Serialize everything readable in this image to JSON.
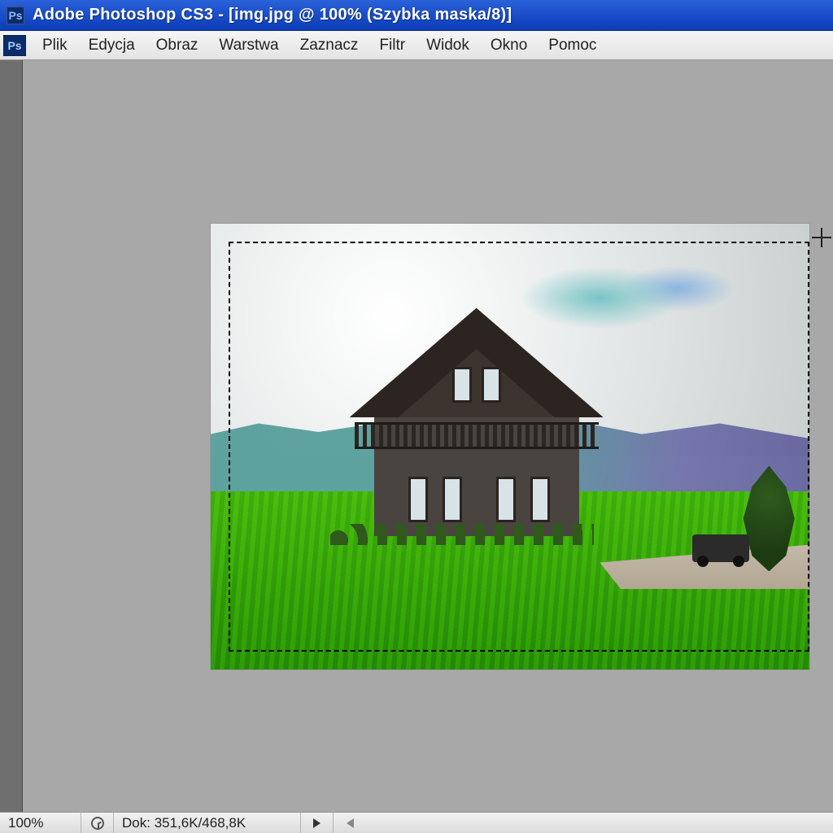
{
  "titlebar": {
    "app_name": "Adobe Photoshop CS3",
    "document_label": "[img.jpg @ 100% (Szybka maska/8)]",
    "full_title": "Adobe Photoshop CS3 - [img.jpg @ 100% (Szybka maska/8)]",
    "app_icon": "Ps"
  },
  "menubar": {
    "icon": "Ps",
    "items": [
      "Plik",
      "Edycja",
      "Obraz",
      "Warstwa",
      "Zaznacz",
      "Filtr",
      "Widok",
      "Okno",
      "Pomoc"
    ]
  },
  "statusbar": {
    "zoom": "100%",
    "dok_label": "Dok:",
    "dok_value": "351,6K/468,8K"
  }
}
